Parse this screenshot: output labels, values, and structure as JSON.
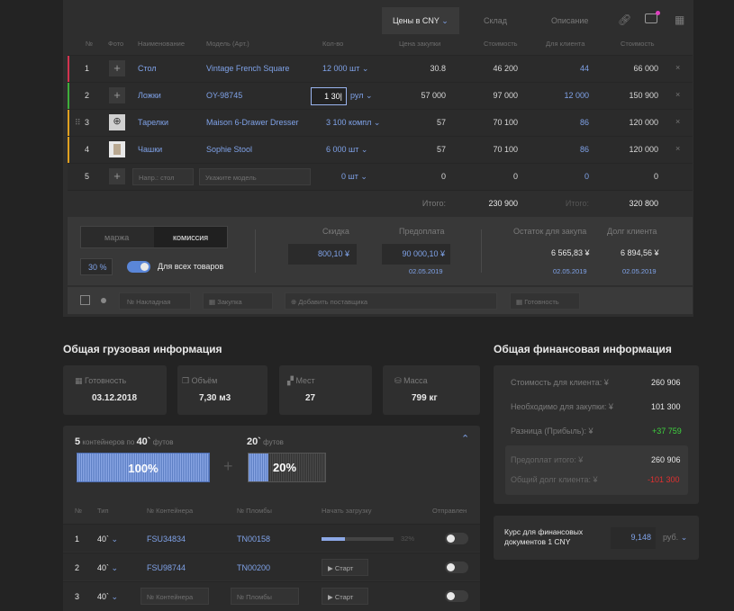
{
  "tabs": {
    "active": "Цены в CNY",
    "t2": "Склад",
    "t3": "Описание"
  },
  "head": [
    "№",
    "Фото",
    "Наименование",
    "Модель (Арт.)",
    "Кол-во",
    "Цена закупки",
    "Стоимость",
    "Для клиента",
    "Стоимость"
  ],
  "rows": [
    {
      "n": "1",
      "name": "Стол",
      "model": "Vintage French Square",
      "qty": "12 000",
      "unit": "шт",
      "price": "30.8",
      "cost": "46 200",
      "client": "44",
      "total": "66 000",
      "color": "#d2334f"
    },
    {
      "n": "2",
      "name": "Ложки",
      "model": "OY-98745",
      "qty": "1 30|",
      "unit": "рул",
      "price": "57 000",
      "cost": "97 000",
      "client": "12 000",
      "total": "150 900",
      "color": "#3fae3a"
    },
    {
      "n": "3",
      "name": "Тарелки",
      "model": "Maison 6-Drawer Dresser",
      "qty": "3 100",
      "unit": "компл",
      "price": "57",
      "cost": "70 100",
      "client": "86",
      "total": "120 000",
      "color": "#e0a020"
    },
    {
      "n": "4",
      "name": "Чашки",
      "model": "Sophie Stool",
      "qty": "6 000",
      "unit": "шт",
      "price": "57",
      "cost": "70 100",
      "client": "86",
      "total": "120 000",
      "color": "#e0a020"
    }
  ],
  "newrow": {
    "n": "5",
    "name_ph": "Напр.: стол",
    "model_ph": "Укажите модель",
    "qty": "0",
    "unit": "шт",
    "price": "0",
    "cost": "0",
    "client": "0",
    "total": "0"
  },
  "totals": {
    "label": "Итого:",
    "cost": "230 900",
    "label2": "Итого:",
    "total": "320 800"
  },
  "pricing": {
    "seg1": "маржа",
    "seg2": "комиссия",
    "pct": "30 %",
    "all": "Для всех товаров",
    "discount_label": "Скидка",
    "discount": "800,10 ¥",
    "prepay_label": "Предоплата",
    "prepay": "90 000,10 ¥",
    "prepay_date": "02.05.2019",
    "rest_label": "Остаток для закупа",
    "rest": "6 565,83 ¥",
    "rest_date": "02.05.2019",
    "debt_label": "Долг клиента",
    "debt": "6 894,56 ¥",
    "debt_date": "02.05.2019"
  },
  "filters": {
    "nakl": "Накладная",
    "zak": "Закупка",
    "supplier": "Добавить поставщика",
    "ready": "Готовность"
  },
  "cargo": {
    "title": "Общая грузовая информация",
    "ready_l": "Готовность",
    "ready_v": "03.12.2018",
    "vol_l": "Объём",
    "vol_v": "7,30 м3",
    "places_l": "Мест",
    "places_v": "27",
    "mass_l": "Масса",
    "mass_v": "799 кг",
    "c40n": "5",
    "c40t": "контейнеров по",
    "c40s": "40`",
    "ft": "футов",
    "c20s": "20`",
    "ft2": "футов",
    "p40": "100%",
    "p20": "20%",
    "th": [
      "№",
      "Тип",
      "№ Контейнера",
      "№ Пломбы",
      "Начать загрузку",
      "Отправлен"
    ],
    "rows": [
      {
        "n": "1",
        "type": "40`",
        "cont": "FSU34834",
        "seal": "TN00158",
        "prog": "32%"
      },
      {
        "n": "2",
        "type": "40`",
        "cont": "FSU98744",
        "seal": "TN00200",
        "start": "Старт"
      },
      {
        "n": "3",
        "type": "40`",
        "cont_ph": "№ Контейнера",
        "seal_ph": "№ Пломбы",
        "start": "Старт"
      }
    ]
  },
  "fin": {
    "title": "Общая финансовая информация",
    "r1l": "Стоимость для клиента: ¥",
    "r1v": "260 906",
    "r2l": "Необходимо для закупки: ¥",
    "r2v": "101 300",
    "r3l": "Разница (Прибыль): ¥",
    "r3v": "+37 759",
    "r4l": "Предоплат итого: ¥",
    "r4v": "260 906",
    "r5l": "Общий долг клиента: ¥",
    "r5v": "-101 300",
    "rate_l": "Курс для финансовых документов 1 CNY",
    "rate_v": "9,148",
    "rate_u": "руб."
  },
  "colors": {
    "accent": "#7fa2e8",
    "green": "#3fd23f",
    "red": "#e03030"
  }
}
